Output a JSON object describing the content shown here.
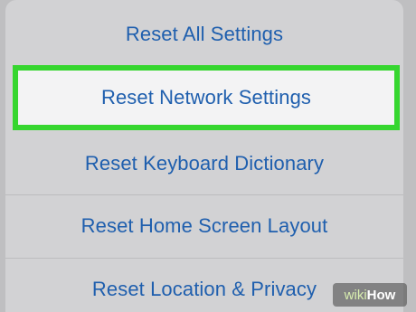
{
  "menu": {
    "items": [
      {
        "label": "Reset All Settings"
      },
      {
        "label": "Reset Network Settings",
        "highlighted": true
      },
      {
        "label": "Reset Keyboard Dictionary"
      },
      {
        "label": "Reset Home Screen Layout"
      },
      {
        "label": "Reset Location & Privacy"
      }
    ]
  },
  "colors": {
    "link_blue": "#1f5fae",
    "highlight_outline": "#36d62f",
    "panel_background": "#d2d2d4",
    "highlight_background": "#f3f3f4"
  },
  "watermark": {
    "prefix": "wiki",
    "suffix": "How"
  }
}
